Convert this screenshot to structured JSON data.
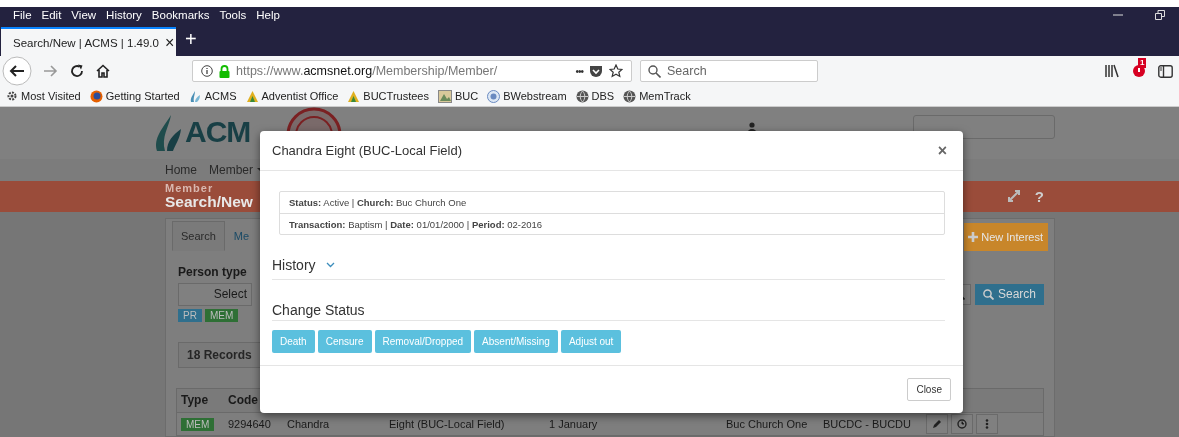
{
  "browser": {
    "menu": [
      "File",
      "Edit",
      "View",
      "History",
      "Bookmarks",
      "Tools",
      "Help"
    ],
    "tab": {
      "title": "Search/New | ACMS | 1.49.0",
      "close": "×",
      "new_tab": "+"
    },
    "url": {
      "prefix": "https://www.",
      "domain": "acmsnet.org",
      "path": "/Membership/Member/"
    },
    "more": "•••",
    "search": {
      "placeholder": "Search"
    },
    "notification_badge": "1",
    "bookmarks": [
      {
        "label": "Most Visited",
        "kind": "gear"
      },
      {
        "label": "Getting Started",
        "kind": "firefox"
      },
      {
        "label": "ACMS",
        "kind": "acms"
      },
      {
        "label": "Adventist Office",
        "kind": "adventist"
      },
      {
        "label": "BUCTrustees",
        "kind": "adventist"
      },
      {
        "label": "BUC",
        "kind": "image"
      },
      {
        "label": "BWebstream",
        "kind": "bw"
      },
      {
        "label": "DBS",
        "kind": "globe"
      },
      {
        "label": "MemTrack",
        "kind": "globe"
      }
    ]
  },
  "page": {
    "logo": "ACM",
    "nav": [
      {
        "label": "Home",
        "dropdown": false
      },
      {
        "label": "Member",
        "dropdown": true
      }
    ],
    "header": {
      "section": "Member",
      "title": "Search/New",
      "help": "?"
    },
    "tabs": [
      {
        "label": "Search",
        "selected": true
      },
      {
        "label": "Me",
        "selected": false
      }
    ],
    "person_type": {
      "label": "Person type",
      "select": "Select"
    },
    "badges": [
      {
        "label": "PR",
        "color": "#2f6f8d"
      },
      {
        "label": "MEM",
        "color": "#2e6f35"
      }
    ],
    "records": "18 Records",
    "new_interest": "New Interest",
    "search_button": "Search",
    "table": {
      "columns": [
        "Type",
        "Code"
      ],
      "rows": [
        {
          "cells": [
            "MEM",
            "9294640",
            "Chandra",
            "Eight (BUC-Local Field)",
            "1 January",
            "",
            "Buc Church One",
            "BUCDC - BUCDU"
          ]
        }
      ]
    }
  },
  "modal": {
    "title": "Chandra Eight (BUC-Local Field)",
    "close": "×",
    "info": [
      "**Status:** Active | **Church:** Buc Church One",
      "**Transaction:** Baptism | **Date:** 01/01/2000 | **Period:** 02-2016"
    ],
    "history": {
      "label": "History",
      "expanded": false
    },
    "change_status": "Change Status",
    "actions": [
      "Death",
      "Censure",
      "Removal/Dropped",
      "Absent/Missing",
      "Adjust out"
    ],
    "footer_button": "Close"
  }
}
